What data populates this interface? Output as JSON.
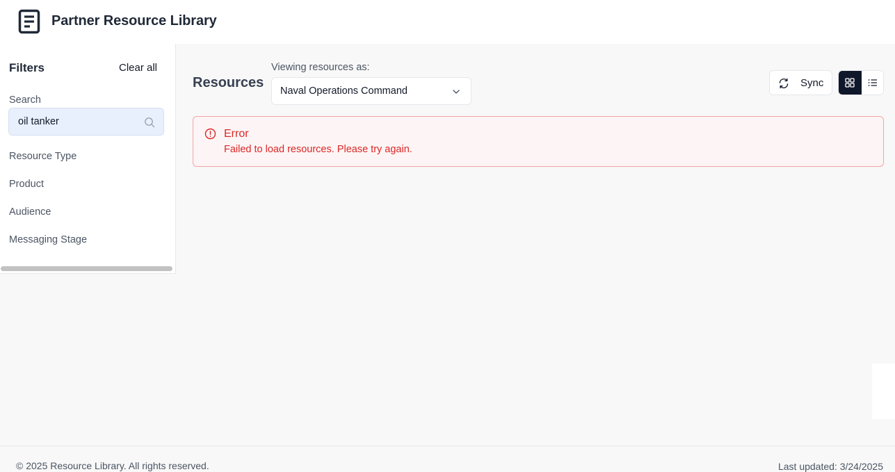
{
  "app": {
    "title": "Partner Resource Library",
    "logo_icon": "document-icon"
  },
  "sidebar": {
    "title": "Filters",
    "clear_all_label": "Clear all",
    "search": {
      "label": "Search",
      "value": "oil tanker",
      "icon": "search-icon"
    },
    "filters": [
      "Resource Type",
      "Product",
      "Audience",
      "Messaging Stage"
    ]
  },
  "main": {
    "title": "Resources",
    "viewing_as_label": "Viewing resources as:",
    "viewing_as_value": "Naval Operations Command",
    "sync_label": "Sync",
    "view_mode": "grid"
  },
  "error": {
    "title": "Error",
    "message": "Failed to load resources. Please try again.",
    "color": "#dc2626"
  },
  "footer": {
    "copyright": "© 2025 Resource Library. All rights reserved.",
    "last_updated": "Last updated: 3/24/2025"
  },
  "colors": {
    "accent_dark": "#0f172a",
    "search_bg": "#e8f0fd",
    "error_border": "#f3a5a5"
  }
}
